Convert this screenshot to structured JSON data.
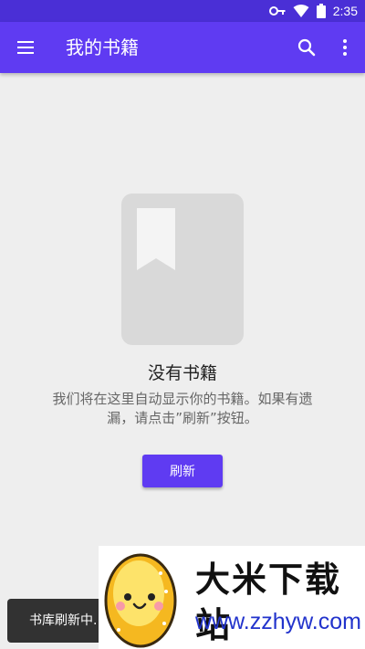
{
  "status_bar": {
    "time": "2:35",
    "icons": [
      "key-icon",
      "wifi-icon",
      "battery-icon"
    ]
  },
  "app_bar": {
    "title": "我的书籍",
    "icons": [
      "menu-icon",
      "search-icon",
      "more-vert-icon"
    ]
  },
  "empty_state": {
    "title": "没有书籍",
    "description": "我们将在这里自动显示你的书籍。如果有遗漏，请点击”刷新”按钮。",
    "button_label": "刷新"
  },
  "snackbar": {
    "text": "书库刷新中..."
  },
  "watermark": {
    "name": "大米下载站",
    "url": "www.zzhyw.com"
  },
  "colors": {
    "primary": "#5f3bf2",
    "status_bar": "#4a2fd6",
    "background": "#eeeeee",
    "illustration": "#d9d9d9"
  }
}
